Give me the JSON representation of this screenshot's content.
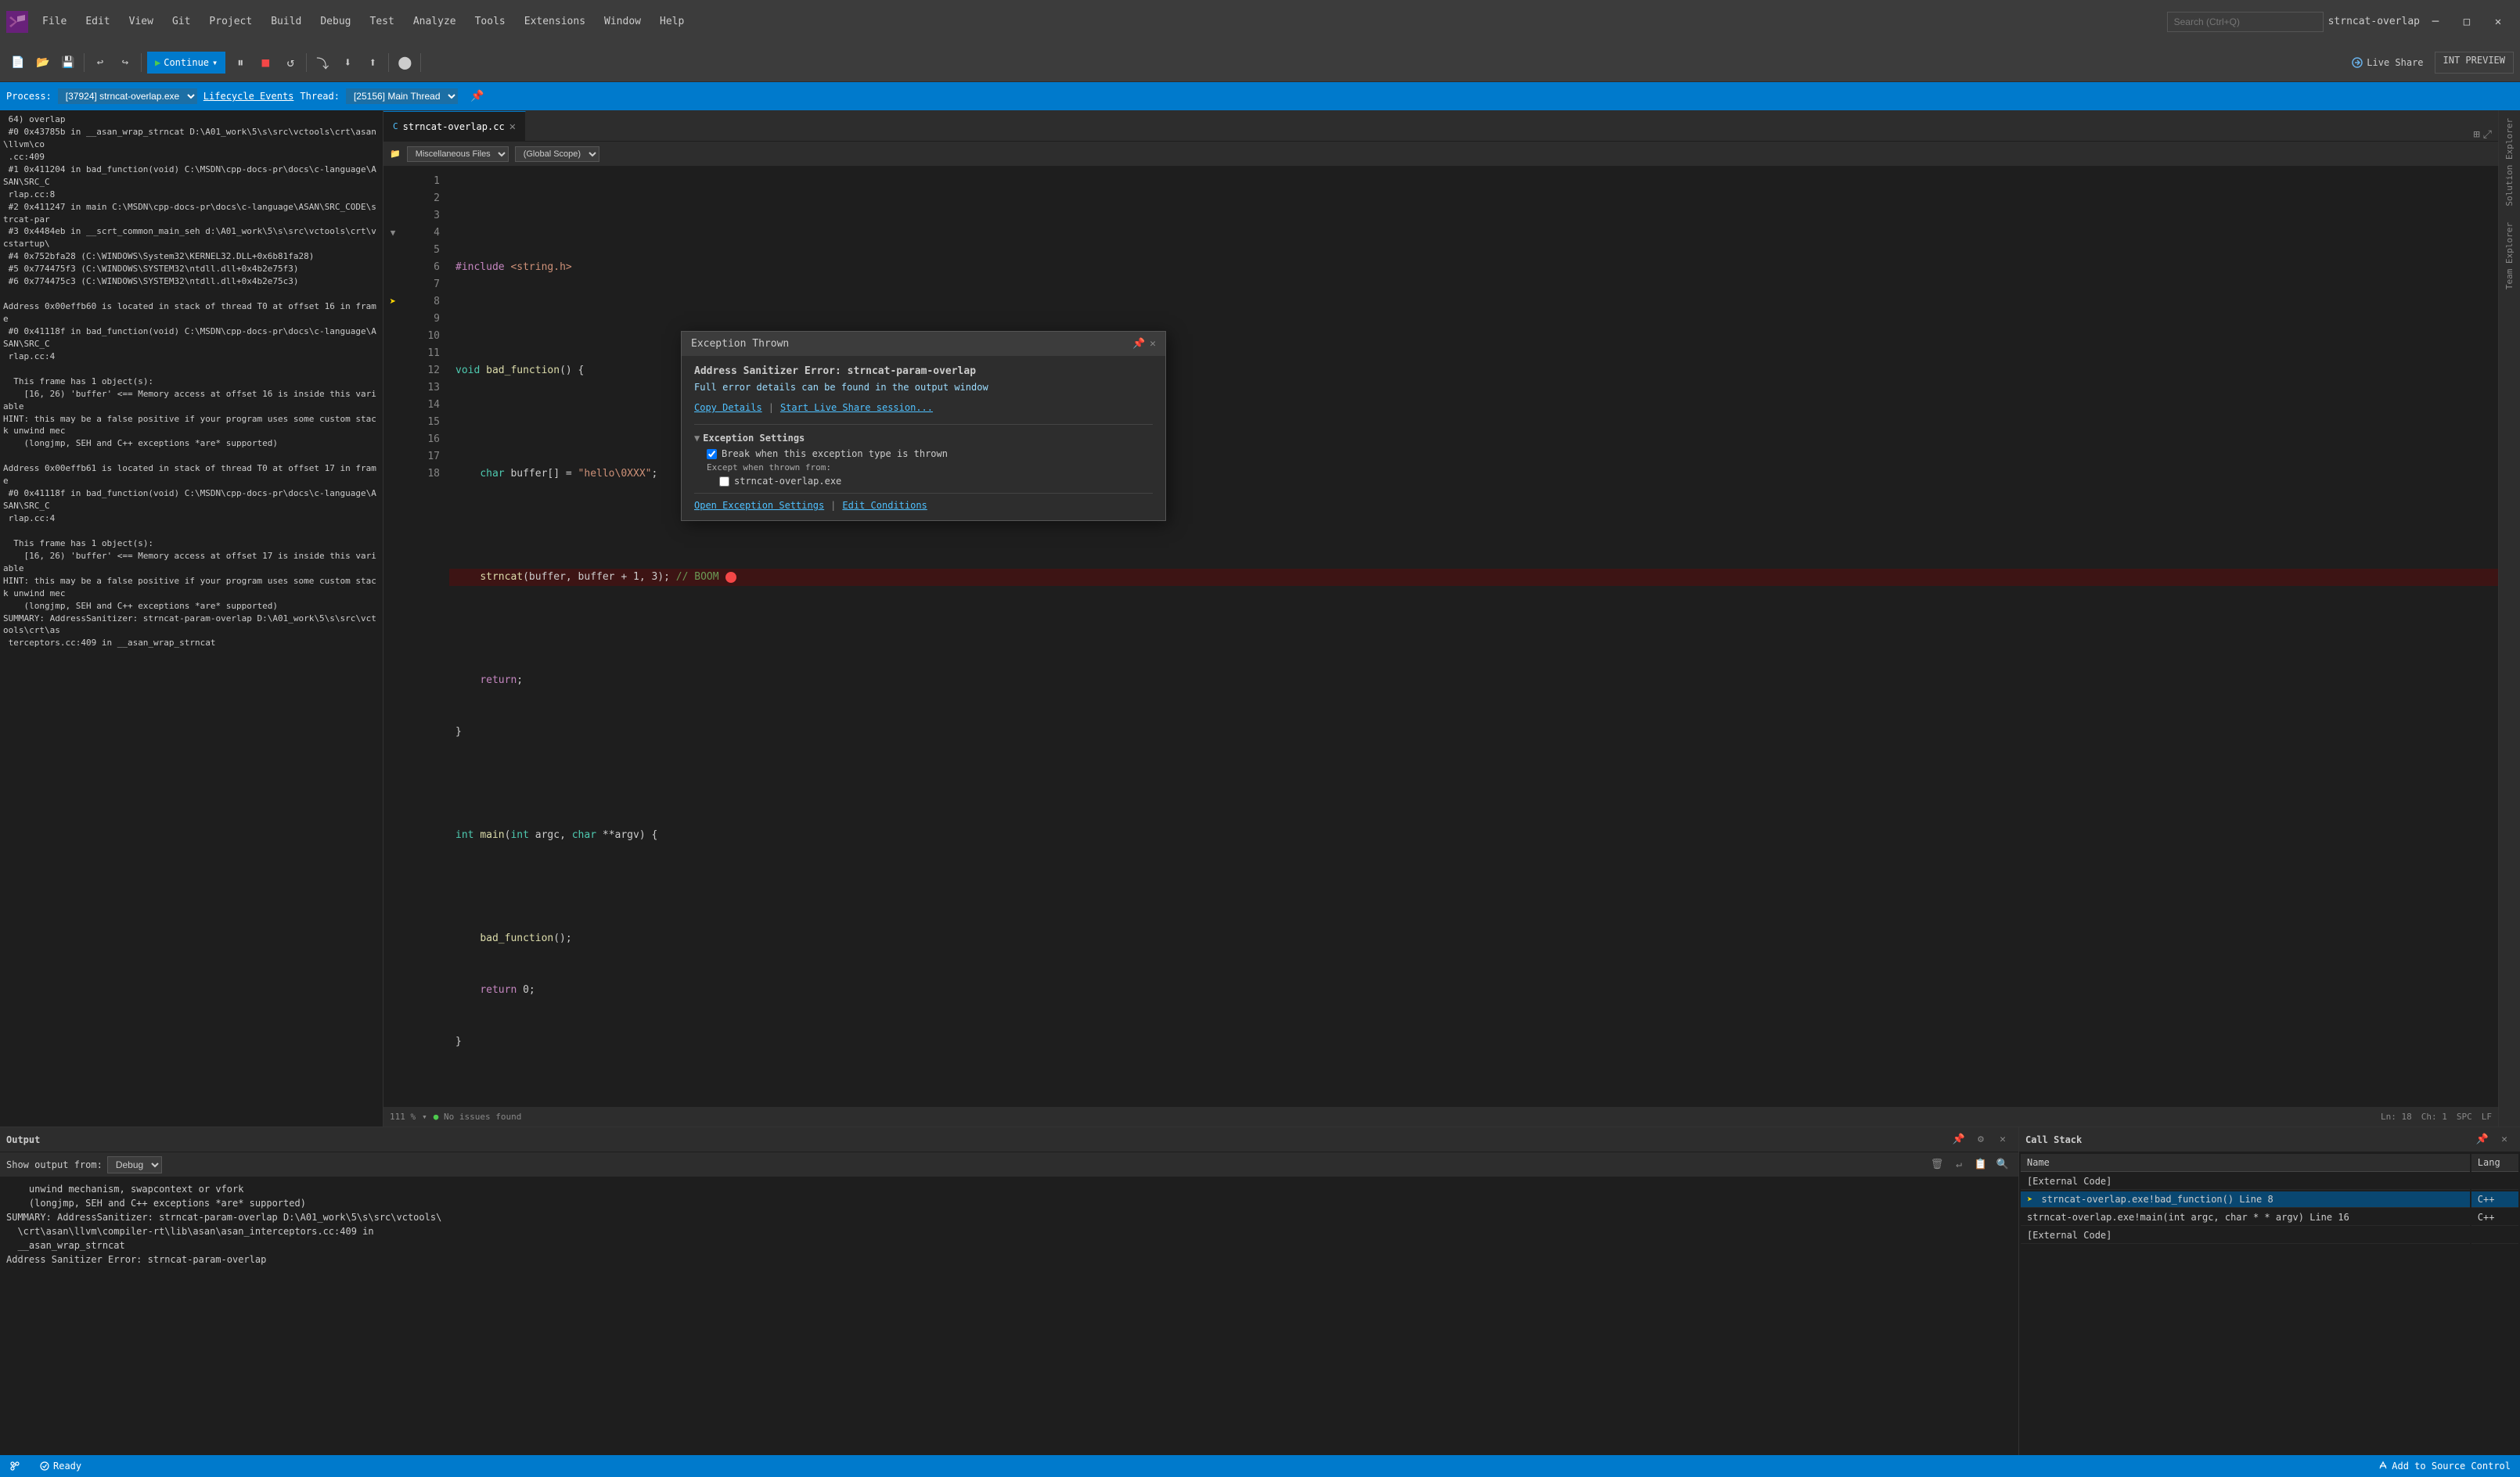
{
  "titlebar": {
    "icon": "VS",
    "menus": [
      "File",
      "Edit",
      "View",
      "Git",
      "Project",
      "Build",
      "Debug",
      "Test",
      "Analyze",
      "Tools",
      "Extensions",
      "Window",
      "Help"
    ],
    "search_placeholder": "Search (Ctrl+Q)",
    "title": "strncat-overlap",
    "min": "─",
    "max": "□",
    "close": "✕"
  },
  "toolbar": {
    "continue_label": "Continue",
    "continue_dropdown": "▾",
    "live_share_label": "Live Share",
    "int_preview_label": "INT PREVIEW"
  },
  "process_bar": {
    "process_label": "Process:",
    "process_value": "[37924] strncat-overlap.exe",
    "lifecycle_label": "Lifecycle Events",
    "thread_label": "Thread:",
    "thread_value": "[25156] Main Thread"
  },
  "left_panel": {
    "content": " 64) overlap\n #0 0x43785b in __asan_wrap_strncat D:\\A01_work\\5\\s\\src\\vctools\\crt\\asan\\llvm\\co\n .cc:409\n #1 0x411204 in bad_function(void) C:\\MSDN\\cpp-docs-pr\\docs\\c-language\\ASAN\\SRC_C\n rlap.cc:8\n #2 0x411247 in main C:\\MSDN\\cpp-docs-pr\\docs\\c-language\\ASAN\\SRC_CODE\\strcat-par\n #3 0x4484eb in __scrt_common_main_seh d:\\A01_work\\5\\s\\src\\vctools\\crt\\vcstartup\\\n #4 0x752bfa28 (C:\\WINDOWS\\System32\\KERNEL32.DLL+0x6b81fa28)\n #5 0x774475f3 (C:\\WINDOWS\\SYSTEM32\\ntdll.dll+0x4b2e75f3)\n #6 0x774475c3 (C:\\WINDOWS\\SYSTEM32\\ntdll.dll+0x4b2e75c3)\n\nAddress 0x00effb60 is located in stack of thread T0 at offset 16 in frame\n #0 0x41118f in bad_function(void) C:\\MSDN\\cpp-docs-pr\\docs\\c-language\\ASAN\\SRC_C\n rlap.cc:4\n\n  This frame has 1 object(s):\n    [16, 26) 'buffer' <== Memory access at offset 16 is inside this variable\nHINT: this may be a false positive if your program uses some custom stack unwind mec\n    (longjmp, SEH and C++ exceptions *are* supported)\n\nAddress 0x00effb61 is located in stack of thread T0 at offset 17 in frame\n #0 0x41118f in bad_function(void) C:\\MSDN\\cpp-docs-pr\\docs\\c-language\\ASAN\\SRC_C\n rlap.cc:4\n\n  This frame has 1 object(s):\n    [16, 26) 'buffer' <== Memory access at offset 17 is inside this variable\nHINT: this may be a false positive if your program uses some custom stack unwind mec\n    (longjmp, SEH and C++ exceptions *are* supported)\nSUMMARY: AddressSanitizer: strncat-param-overlap D:\\A01_work\\5\\s\\src\\vctools\\crt\\as\n terceptors.cc:409 in __asan_wrap_strncat"
  },
  "tabs": {
    "items": [
      {
        "label": "strncat-overlap.cc",
        "active": true,
        "modified": false
      }
    ]
  },
  "file_path": {
    "misc_files": "Miscellaneous Files",
    "scope": "(Global Scope)"
  },
  "editor": {
    "lines": [
      {
        "num": 1,
        "code": ""
      },
      {
        "num": 2,
        "code": "    #include <string.h>"
      },
      {
        "num": 3,
        "code": ""
      },
      {
        "num": 4,
        "code": "void bad_function() {"
      },
      {
        "num": 5,
        "code": ""
      },
      {
        "num": 6,
        "code": "    char buffer[] = \"hello\\0XXX\";"
      },
      {
        "num": 7,
        "code": ""
      },
      {
        "num": 8,
        "code": "    strncat(buffer, buffer + 1, 3); // BOOM"
      },
      {
        "num": 9,
        "code": ""
      },
      {
        "num": 10,
        "code": "    return;"
      },
      {
        "num": 11,
        "code": "}"
      },
      {
        "num": 12,
        "code": ""
      },
      {
        "num": 13,
        "code": "int main(int argc, char **argv) {"
      },
      {
        "num": 14,
        "code": ""
      },
      {
        "num": 15,
        "code": "    bad_function();"
      },
      {
        "num": 16,
        "code": "    return 0;"
      },
      {
        "num": 17,
        "code": "}"
      },
      {
        "num": 18,
        "code": ""
      }
    ]
  },
  "exception": {
    "title": "Exception Thrown",
    "error_title": "Address Sanitizer Error: strncat-param-overlap",
    "subtitle": "Full error details can be found in the output window",
    "copy_link": "Copy Details",
    "live_share_link": "Start Live Share session...",
    "settings_title": "Exception Settings",
    "break_label": "Break when this exception type is thrown",
    "except_label": "Except when thrown from:",
    "exe_label": "strncat-overlap.exe",
    "open_link": "Open Exception Settings",
    "edit_link": "Edit Conditions"
  },
  "status_bar": {
    "zoom": "111 %",
    "issues": "No issues found",
    "line": "Ln: 18",
    "col": "Ch: 1",
    "spc": "SPC",
    "lf": "LF"
  },
  "output_panel": {
    "title": "Output",
    "show_from_label": "Show output from:",
    "debug_option": "Debug",
    "content": "    unwind mechanism, swapcontext or vfork\n    (longjmp, SEH and C++ exceptions *are* supported)\nSUMMARY: AddressSanitizer: strncat-param-overlap D:\\A01_work\\5\\s\\src\\vctools\\\n  \\crt\\asan\\llvm\\compiler-rt\\lib\\asan\\asan_interceptors.cc:409 in\n  __asan_wrap_strncat\nAddress Sanitizer Error: strncat-param-overlap"
  },
  "call_stack_panel": {
    "title": "Call Stack",
    "col_name": "Name",
    "col_lang": "Lang",
    "rows": [
      {
        "name": "[External Code]",
        "lang": "",
        "active": false,
        "indent": 0
      },
      {
        "name": "strncat-overlap.exe!bad_function() Line 8",
        "lang": "C++",
        "active": true,
        "indent": 2
      },
      {
        "name": "strncat-overlap.exe!main(int argc, char * * argv) Line 16",
        "lang": "C++",
        "active": false,
        "indent": 2
      },
      {
        "name": "[External Code]",
        "lang": "",
        "active": false,
        "indent": 0
      }
    ]
  },
  "bottom_status": {
    "ready": "Ready",
    "source_control": "Add to Source Control"
  },
  "right_sidebar": {
    "tabs": [
      "Solution Explorer",
      "Team Explorer"
    ]
  }
}
